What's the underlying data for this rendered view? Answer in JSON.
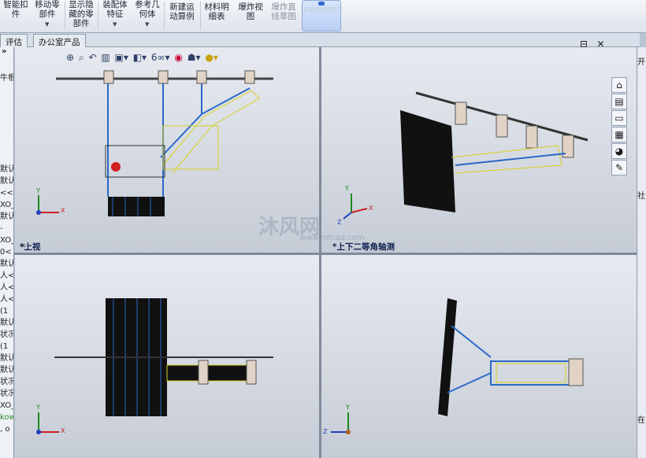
{
  "ribbon": {
    "buttons": [
      {
        "label": "智能扣件",
        "lines": [
          "智能扣",
          "件"
        ],
        "enabled": true
      },
      {
        "label": "移动零部件",
        "lines": [
          "移动零",
          "部件"
        ],
        "enabled": true,
        "dropdown": true
      },
      {
        "label": "显示隐藏的零部件",
        "lines": [
          "显示隐",
          "藏的零",
          "部件"
        ],
        "enabled": true
      },
      {
        "label": "装配体特征",
        "lines": [
          "装配体",
          "特征"
        ],
        "enabled": true,
        "dropdown": true
      },
      {
        "label": "参考几何体",
        "lines": [
          "参考几",
          "何体"
        ],
        "enabled": true,
        "dropdown": true
      },
      {
        "label": "新建运动算例",
        "lines": [
          "新建运",
          "动算例"
        ],
        "enabled": true
      },
      {
        "label": "材料明细表",
        "lines": [
          "材料明",
          "细表"
        ],
        "enabled": true
      },
      {
        "label": "爆炸视图",
        "lines": [
          "爆炸视",
          "图"
        ],
        "enabled": true
      },
      {
        "label": "爆炸直线草图",
        "lines": [
          "爆炸直",
          "线草图"
        ],
        "enabled": false
      }
    ],
    "instant3d": "Instant3D"
  },
  "tabs": [
    "评估",
    "办公室产品"
  ],
  "left_strip": {
    "expand": "»",
    "items": [
      "牛根",
      "",
      "",
      "默认",
      "默认",
      "<<",
      "XO_",
      "默认",
      "-",
      "XO_",
      "0<",
      "默认",
      "人<",
      "人<",
      "人<",
      "(1",
      "默认",
      "状况",
      "(1",
      "默认",
      "默认",
      "状况",
      "状况",
      "XO_",
      "kow",
      ", o"
    ]
  },
  "view_toolbar": {
    "icons": [
      "zoom-to-fit-icon",
      "zoom-area-icon",
      "previous-view-icon",
      "section-view-icon",
      "view-orientation-icon",
      "display-style-icon",
      "hide-show-icon",
      "edit-appearance-icon",
      "apply-scene-icon",
      "view-settings-icon"
    ]
  },
  "window_controls": {
    "link": "∞",
    "restore": "⊟",
    "close": "✕"
  },
  "viewports": [
    {
      "label": "*上视",
      "triad": {
        "x": "X",
        "y": "Y"
      }
    },
    {
      "label": "*上下二等角轴测",
      "triad": {
        "x": "X",
        "y": "Y",
        "z": "Z"
      }
    },
    {
      "label": "",
      "triad": {
        "x": "X",
        "y": "Y"
      }
    },
    {
      "label": "",
      "triad": {
        "z": "Z",
        "y": "Y"
      }
    }
  ],
  "task_pane_tabs": [
    "home-icon",
    "design-library-icon",
    "file-explorer-icon",
    "view-palette-icon",
    "appearances-icon",
    "custom-properties-icon"
  ],
  "right_edge_labels": [
    "开",
    "社",
    "在"
  ],
  "watermark": {
    "text": "沐风网",
    "url": "www.mfcad.com"
  },
  "colors": {
    "accent": "#2f6bd1",
    "viewport_bg": "#dfe3ea",
    "structure_blue": "#2a68c8",
    "highlight_yellow": "#d8d020"
  }
}
